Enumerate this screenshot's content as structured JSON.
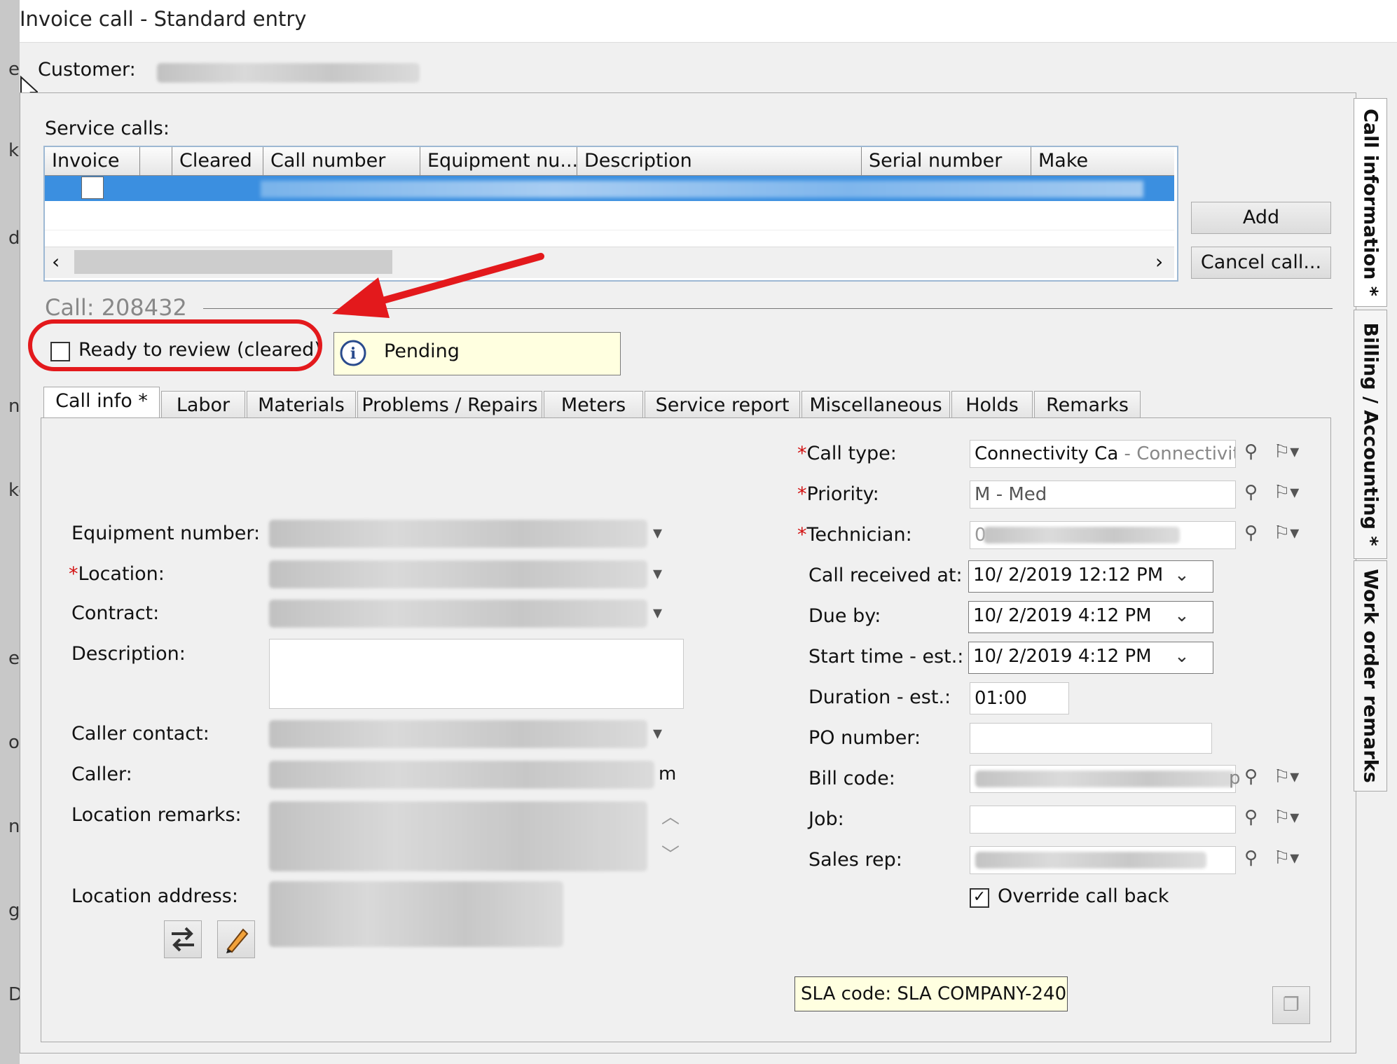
{
  "window": {
    "title": "Invoice call - Standard entry"
  },
  "left_fragments": [
    "e",
    "k",
    "d!",
    "n.",
    "ke",
    "e",
    "o",
    "n",
    "g",
    "D"
  ],
  "customer": {
    "label": "Customer:"
  },
  "service_calls": {
    "label": "Service calls:",
    "columns": [
      "Invoice",
      "",
      "Cleared",
      "Call number",
      "Equipment nu...",
      "Description",
      "Serial number",
      "Make"
    ],
    "add_label": "Add",
    "cancel_label": "Cancel call..."
  },
  "call": {
    "heading": "Call: 208432",
    "ready_label": "Ready to review (cleared)",
    "status": "Pending"
  },
  "tabs": [
    "Call info *",
    "Labor",
    "Materials",
    "Problems / Repairs",
    "Meters",
    "Service report",
    "Miscellaneous",
    "Holds",
    "Remarks"
  ],
  "side_tabs": [
    "Call information *",
    "Billing / Accounting *",
    "Work order remarks"
  ],
  "left_form": {
    "equipment_number": "Equipment number:",
    "location": "Location:",
    "contract": "Contract:",
    "description": "Description:",
    "caller_contact": "Caller contact:",
    "caller": "Caller:",
    "caller_suffix": "m",
    "location_remarks": "Location remarks:",
    "location_address": "Location address:"
  },
  "right_form": {
    "call_type": {
      "label": "Call type:",
      "code": "Connectivity Ca",
      "desc": " - Connectivity C"
    },
    "priority": {
      "label": "Priority:",
      "value": "M - Med"
    },
    "technician": {
      "label": "Technician:",
      "value": "0"
    },
    "call_received": {
      "label": "Call received at:",
      "value": "10/  2/2019  12:12 PM"
    },
    "due_by": {
      "label": "Due by:",
      "value": "10/  2/2019    4:12 PM"
    },
    "start_time": {
      "label": "Start time - est.:",
      "value": "10/  2/2019    4:12 PM"
    },
    "duration": {
      "label": "Duration - est.:",
      "value": "01:00"
    },
    "po_number": {
      "label": "PO number:",
      "value": ""
    },
    "bill_code": {
      "label": "Bill code:",
      "value": "p"
    },
    "job": {
      "label": "Job:",
      "value": ""
    },
    "sales_rep": {
      "label": "Sales rep:",
      "value": ""
    },
    "override": {
      "label": "Override call back",
      "checked": true
    }
  },
  "sla": "SLA code: SLA COMPANY-240",
  "colors": {
    "annotation_red": "#e3191c",
    "status_bg": "#ffffe0",
    "selection_blue": "#3b8fe0",
    "required_red": "#d21010"
  }
}
